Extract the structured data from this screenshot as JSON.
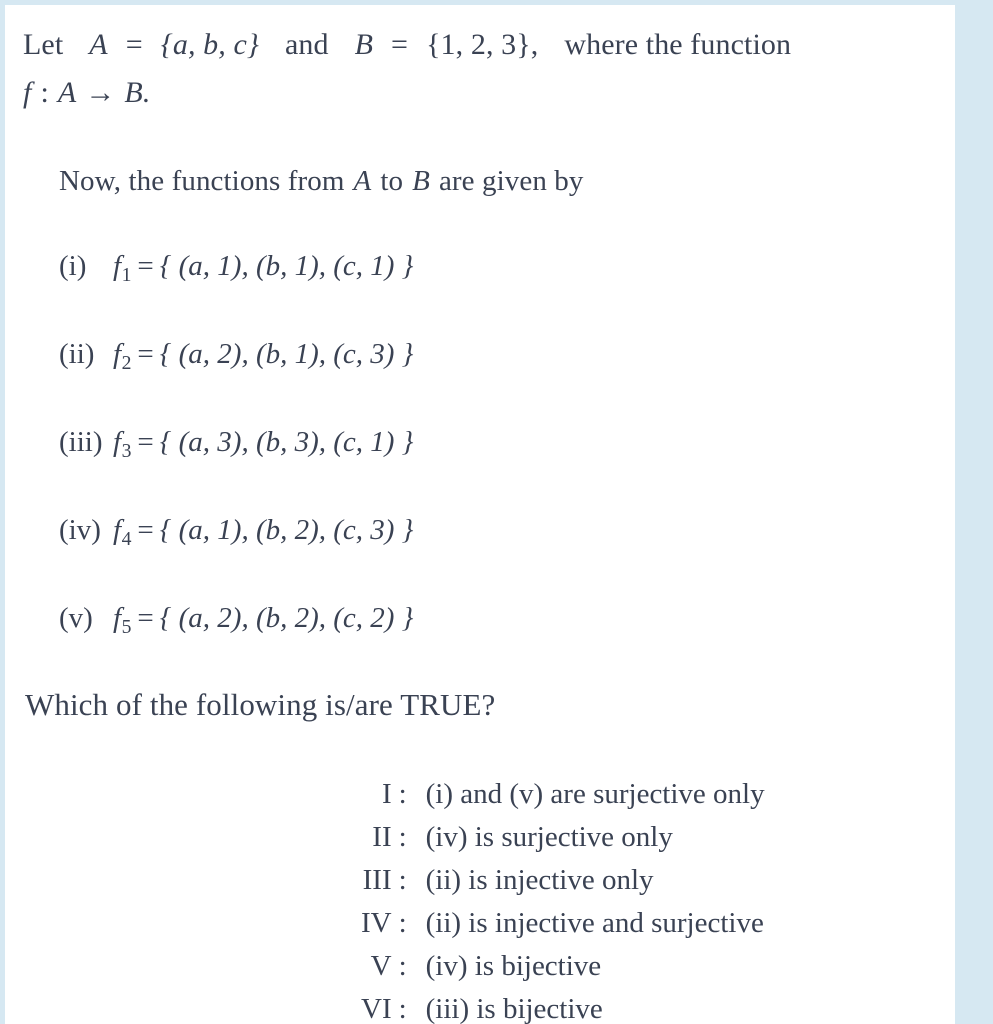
{
  "document": {
    "background_color": "#d6e8f2",
    "paper_color": "#ffffff",
    "text_color": "#3a4253"
  },
  "intro": {
    "line1_part1": "Let",
    "line1_setA_name": "A",
    "line1_eq1": "=",
    "line1_setA_value": "{a, b, c}",
    "line1_and": "and",
    "line1_setB_name": "B",
    "line1_eq2": "=",
    "line1_setB_value": "{1, 2, 3},",
    "line1_tail": "where the function",
    "line2_fn": "f",
    "line2_colon": ":",
    "line2_domain": "A",
    "line2_arrow": "→",
    "line2_codomain": "B."
  },
  "now_statement": {
    "prefix": "Now, the functions from",
    "domain": "A",
    "middle": "to",
    "codomain": "B",
    "suffix": "are given by"
  },
  "functions": [
    {
      "tag": "(i)",
      "name": "f",
      "index": "1",
      "equals": "=",
      "value": "{ (a, 1), (b, 1), (c, 1) }",
      "pairs": [
        [
          "a",
          1
        ],
        [
          "b",
          1
        ],
        [
          "c",
          1
        ]
      ]
    },
    {
      "tag": "(ii)",
      "name": "f",
      "index": "2",
      "equals": "=",
      "value": "{ (a, 2), (b, 1), (c, 3) }",
      "pairs": [
        [
          "a",
          2
        ],
        [
          "b",
          1
        ],
        [
          "c",
          3
        ]
      ]
    },
    {
      "tag": "(iii)",
      "name": "f",
      "index": "3",
      "equals": "=",
      "value": "{ (a, 3), (b, 3), (c, 1) }",
      "pairs": [
        [
          "a",
          3
        ],
        [
          "b",
          3
        ],
        [
          "c",
          1
        ]
      ]
    },
    {
      "tag": "(iv)",
      "name": "f",
      "index": "4",
      "equals": "=",
      "value": "{ (a, 1), (b, 2), (c, 3) }",
      "pairs": [
        [
          "a",
          1
        ],
        [
          "b",
          2
        ],
        [
          "c",
          3
        ]
      ]
    },
    {
      "tag": "(v)",
      "name": "f",
      "index": "5",
      "equals": "=",
      "value": "{ (a, 2), (b, 2), (c, 2) }",
      "pairs": [
        [
          "a",
          2
        ],
        [
          "b",
          2
        ],
        [
          "c",
          2
        ]
      ]
    }
  ],
  "question": {
    "text": "Which of the following is/are TRUE?"
  },
  "options": [
    {
      "numeral": "I",
      "colon": ":",
      "text": "(i) and (v) are surjective only"
    },
    {
      "numeral": "II",
      "colon": ":",
      "text": "(iv) is surjective only"
    },
    {
      "numeral": "III",
      "colon": ":",
      "text": "(ii) is injective only"
    },
    {
      "numeral": "IV",
      "colon": ":",
      "text": "(ii) is injective and surjective"
    },
    {
      "numeral": "V",
      "colon": ":",
      "text": "(iv) is bijective"
    },
    {
      "numeral": "VI",
      "colon": ":",
      "text": "(iii) is bijective"
    }
  ]
}
